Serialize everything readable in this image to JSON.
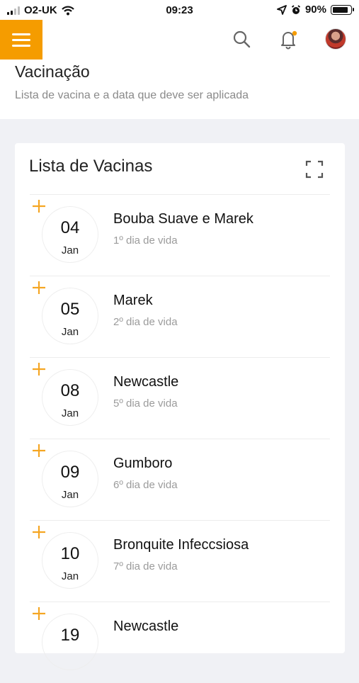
{
  "status_bar": {
    "carrier": "O2-UK",
    "time": "09:23",
    "battery": "90%",
    "icons": [
      "signal-icon",
      "wifi-icon",
      "location-icon",
      "alarm-icon",
      "battery-icon"
    ]
  },
  "app_bar": {
    "icons": [
      "menu-icon",
      "search-icon",
      "bell-icon",
      "avatar"
    ],
    "accent_color": "#f59c00",
    "notification_dot_color": "#f59c00"
  },
  "page": {
    "title": "Vacinação",
    "subtitle": "Lista de vacina e a data que deve ser aplicada"
  },
  "card": {
    "title": "Lista de Vacinas",
    "expand_icon": "expand-icon",
    "items": [
      {
        "day": "04",
        "month": "Jan",
        "name": "Bouba Suave e Marek",
        "subtitle": "1º dia de vida"
      },
      {
        "day": "05",
        "month": "Jan",
        "name": "Marek",
        "subtitle": "2º dia de vida"
      },
      {
        "day": "08",
        "month": "Jan",
        "name": "Newcastle",
        "subtitle": "5º dia de vida"
      },
      {
        "day": "09",
        "month": "Jan",
        "name": "Gumboro",
        "subtitle": "6º dia de vida"
      },
      {
        "day": "10",
        "month": "Jan",
        "name": "Bronquite Infeccsiosa",
        "subtitle": "7º dia de vida"
      },
      {
        "day": "19",
        "month": "",
        "name": "Newcastle",
        "subtitle": ""
      }
    ]
  }
}
